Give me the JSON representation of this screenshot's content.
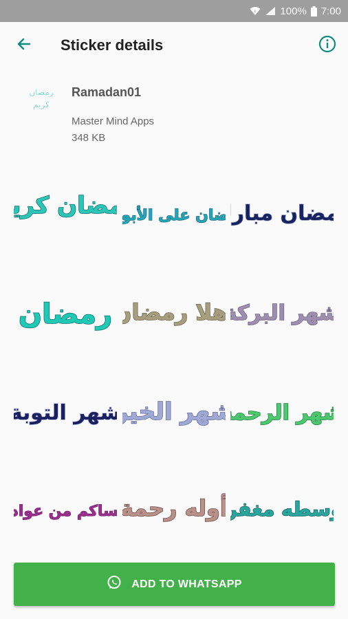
{
  "status_bar": {
    "battery_percent": "100%",
    "time": "7:00",
    "icons": [
      "wifi-icon",
      "signal-icon",
      "battery-icon"
    ]
  },
  "toolbar": {
    "title": "Sticker details",
    "back_icon": "arrow-left-icon",
    "info_icon": "info-icon",
    "accent_color": "#12897d"
  },
  "pack": {
    "name": "Ramadan01",
    "publisher": "Master Mind Apps",
    "size": "348 KB"
  },
  "stickers": [
    {
      "text": "رمضان كريم",
      "color": "#2cc6b8"
    },
    {
      "text": "رمضان على الأبواب",
      "color": "#25a6b8"
    },
    {
      "text": "رمضان مبارك",
      "color": "#17235e"
    },
    {
      "text": "رمضان",
      "color": "#1ecab6"
    },
    {
      "text": "أهلا رمضان",
      "color": "#a69e7e"
    },
    {
      "text": "شهر البركة",
      "color": "#9f8fae"
    },
    {
      "text": "شهر التوبة",
      "color": "#1b2060"
    },
    {
      "text": "شهر الخير",
      "color": "#a0a8d6"
    },
    {
      "text": "شهر الرحمة",
      "color": "#4cc96e"
    },
    {
      "text": "عساكم من عواده",
      "color": "#9b2d8f"
    },
    {
      "text": "أوله رحمة",
      "color": "#b9918a"
    },
    {
      "text": "أوسطه مغفرة",
      "color": "#2aa6a0"
    }
  ],
  "add_button": {
    "label": "ADD TO WHATSAPP",
    "icon": "whatsapp-icon",
    "color": "#43b14a"
  }
}
